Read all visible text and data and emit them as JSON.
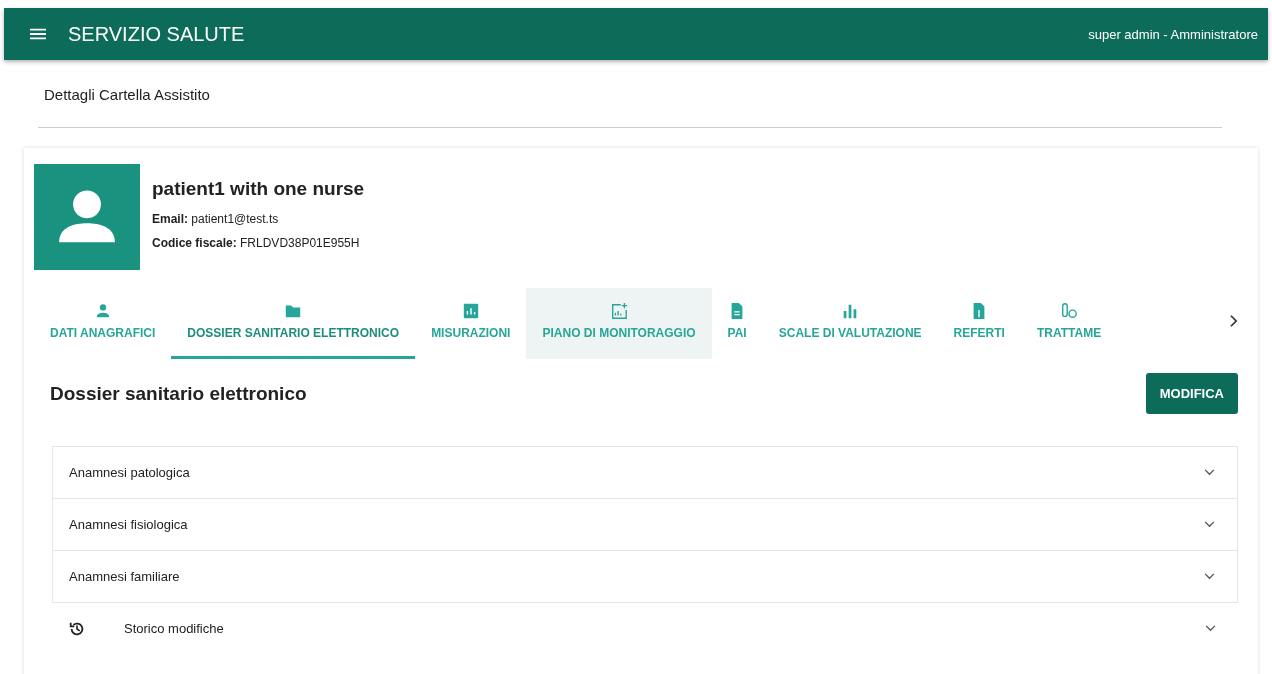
{
  "app_bar": {
    "title": "SERVIZIO SALUTE",
    "user": "super admin - Amministratore"
  },
  "page_title": "Dettagli Cartella Assistito",
  "patient": {
    "name": "patient1 with one nurse",
    "email_label": "Email:",
    "email": "patient1@test.ts",
    "cf_label": "Codice fiscale:",
    "cf": "FRLDVD38P01E955H"
  },
  "tabs": [
    {
      "label": "DATI ANAGRAFICI",
      "selected": false,
      "hovered": false
    },
    {
      "label": "DOSSIER SANITARIO ELETTRONICO",
      "selected": true,
      "hovered": false
    },
    {
      "label": "MISURAZIONI",
      "selected": false,
      "hovered": false
    },
    {
      "label": "PIANO DI MONITORAGGIO",
      "selected": false,
      "hovered": true
    },
    {
      "label": "PAI",
      "selected": false,
      "hovered": false
    },
    {
      "label": "SCALE DI VALUTAZIONE",
      "selected": false,
      "hovered": false
    },
    {
      "label": "REFERTI",
      "selected": false,
      "hovered": false
    },
    {
      "label": "TRATTAME",
      "selected": false,
      "hovered": false
    }
  ],
  "section": {
    "title": "Dossier sanitario elettronico",
    "button": "MODIFICA"
  },
  "panels": [
    {
      "label": "Anamnesi patologica",
      "kind": "panel",
      "expanded": false
    },
    {
      "label": "Anamnesi fisiologica",
      "kind": "panel",
      "expanded": false
    },
    {
      "label": "Anamnesi familiare",
      "kind": "panel",
      "expanded": false
    },
    {
      "label": "Storico modifiche",
      "kind": "history",
      "expanded": false
    }
  ]
}
